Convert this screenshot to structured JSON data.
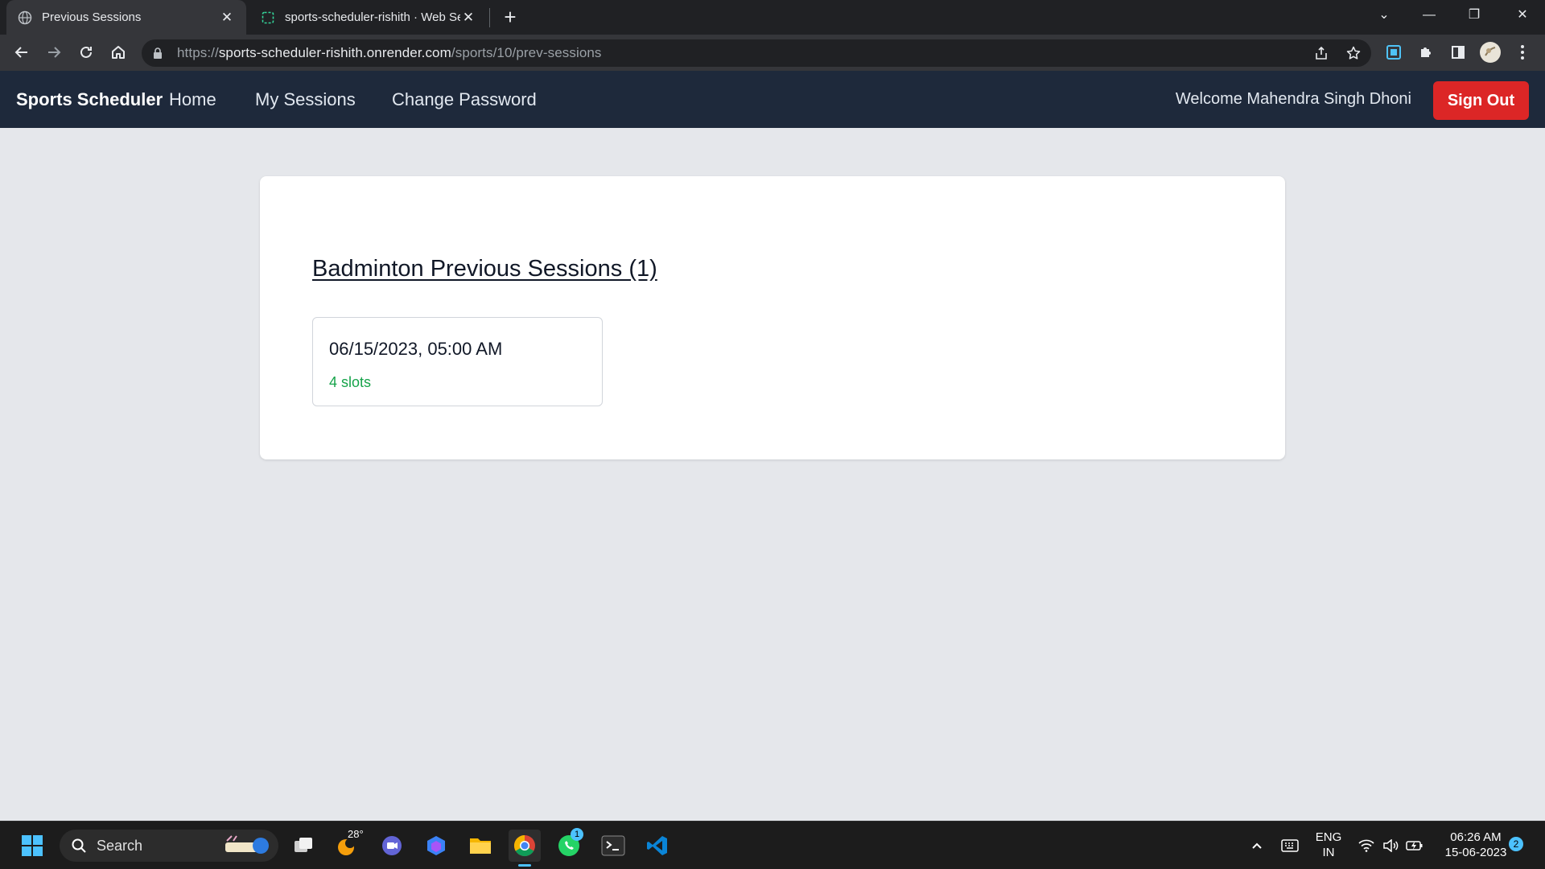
{
  "browser": {
    "tabs": [
      {
        "title": "Previous Sessions",
        "active": true
      },
      {
        "title": "sports-scheduler-rishith · Web Se",
        "active": false
      }
    ],
    "url_scheme": "https://",
    "url_host": "sports-scheduler-rishith.onrender.com",
    "url_path": "/sports/10/prev-sessions"
  },
  "app": {
    "brand": "Sports Scheduler",
    "nav": {
      "home": "Home",
      "my_sessions": "My Sessions",
      "change_password": "Change Password"
    },
    "welcome": "Welcome Mahendra Singh Dhoni",
    "signout": "Sign Out"
  },
  "content": {
    "heading": "Badminton Previous Sessions (1)",
    "sessions": [
      {
        "datetime": "06/15/2023, 05:00 AM",
        "slots": "4 slots"
      }
    ]
  },
  "taskbar": {
    "search_label": "Search",
    "weather_temp": "28°",
    "whatsapp_badge": "1",
    "lang_line1": "ENG",
    "lang_line2": "IN",
    "time": "06:26 AM",
    "date": "15-06-2023",
    "notification_count": "2"
  },
  "colors": {
    "navbar": "#1e293b",
    "signout": "#dc2626",
    "slots_green": "#16a34a",
    "page_bg": "#e5e7eb"
  }
}
